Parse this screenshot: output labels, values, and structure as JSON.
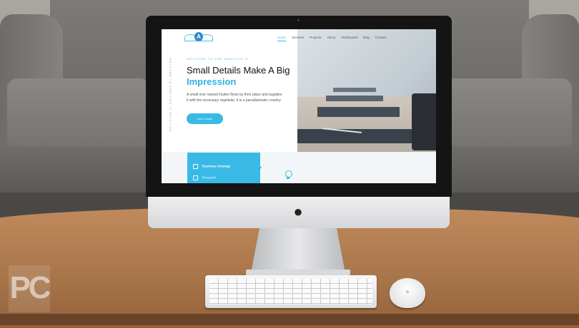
{
  "website": {
    "logo_mark": "A",
    "nav": [
      "Home",
      "Services",
      "Projects",
      "About",
      "Testimonial",
      "Blog",
      "Contact"
    ],
    "vertical_text": "WELCOME TO AMBITION IT SOLUTION",
    "eyebrow": "WELCOME TO THE AMBITION IT",
    "headline": "Small Details Make A Big",
    "headline_accent": "Impression",
    "body": "A small river named Duden flows by their place and supplies it with the necessary regelialia. It is a paradisematic country.",
    "cta_label": "Get in touch",
    "services": [
      "Business Strategy",
      "Research"
    ],
    "accent_color": "#39b9e6"
  },
  "watermark": {
    "text": "PC"
  },
  "icons": {
    "apple": "apple-logo-icon",
    "bulb": "lightbulb-icon"
  }
}
